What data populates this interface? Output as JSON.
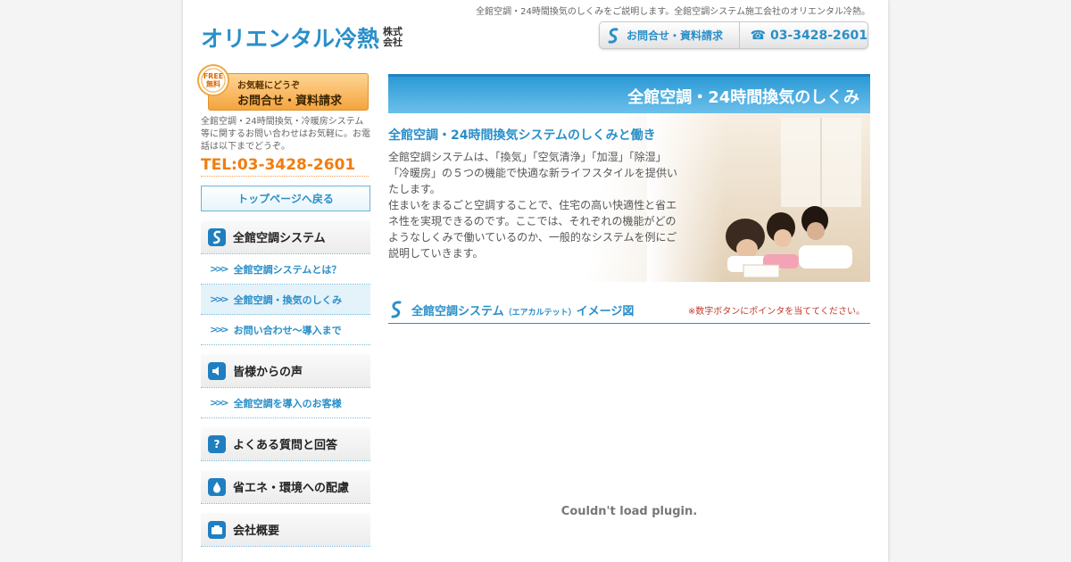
{
  "header": {
    "tagline": "全館空調・24時間換気のしくみをご説明します。全館空調システム施工会社のオリエンタル冷熱。",
    "logo_text": "オリエンタル冷熱",
    "logo_suffix_1": "株式",
    "logo_suffix_2": "会社",
    "contact_label": "お問合せ・資料請求",
    "phone": "☎ 03-3428-2601"
  },
  "sidebar": {
    "free_badge_1": "FREE",
    "free_badge_2": "無料",
    "free_small": "お気軽にどうぞ",
    "free_large": "お問合せ・資料請求",
    "description": "全館空調・24時間換気・冷暖房システム等に関するお問い合わせはお気軽に。お電話は以下までどうぞ。",
    "tel": "TEL:03-3428-2601",
    "top_page": "トップページへ戻る",
    "groups": [
      {
        "title": "全館空調システム",
        "items": [
          "全館空調システムとは？",
          "全館空調・換気のしくみ",
          "お問い合わせ〜導入まで"
        ]
      },
      {
        "title": "皆様からの声",
        "items": [
          "全館空調を導入のお客様"
        ]
      },
      {
        "title": "よくある質問と回答",
        "items": []
      },
      {
        "title": "省エネ・環境への配慮",
        "items": []
      },
      {
        "title": "会社概要",
        "items": []
      }
    ]
  },
  "main": {
    "banner_title": "全館空調・24時間換気のしくみ",
    "subtitle": "全館空調・24時間換気システムのしくみと働き",
    "body": "全館空調システムは、「換気」「空気清浄」「加湿」「除湿」「冷暖房」の５つの機能で快適な新ライフスタイルを提供いたします。\n住まいをまるごと空調することで、住宅の高い快適性と省エネ性を実現できるのです。ここでは、それぞれの機能がどのようなしくみで働いているのか、一般的なシステムを例にご説明していきます。",
    "section_title": "全館空調システム",
    "section_title_small": "（エアカルテット）",
    "section_title_end": "イメージ図",
    "section_note": "※数字ボタンにポインタを当ててください。",
    "plugin_message": "Couldn't load plugin."
  },
  "colors": {
    "accent_blue": "#2a8fc9",
    "orange": "#f07d10",
    "note_red": "#c0392b"
  }
}
